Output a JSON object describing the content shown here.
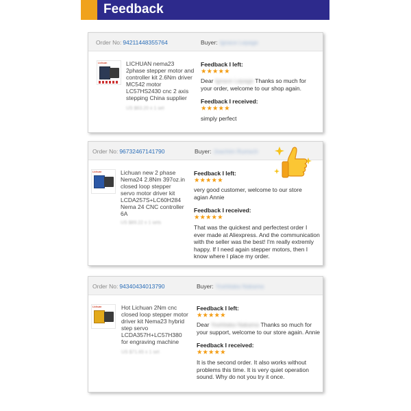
{
  "header": {
    "title": "Feedback"
  },
  "labels": {
    "order_no": "Order No:",
    "buyer": "Buyer:",
    "feedback_left": "Feedback I left:",
    "feedback_received": "Feedback I received:"
  },
  "orders": [
    {
      "order_no": "94211448355764",
      "buyer": "Ignace Lepage",
      "product": "LICHUAN nema23 2phase stepper motor and controller kit 2.6Nm driver MC542 motor LC57HS2430 cnc 2 axis stepping China supplier",
      "price": "US $63.20 x 1 set",
      "stars_left": "★★★★★",
      "left_prefix": "Dear",
      "left_name": "Ignace Lepage",
      "left_text": "Thanks so much for your order, welcome to our shop again.",
      "stars_received": "★★★★★",
      "received_text": "simply perfect"
    },
    {
      "order_no": "96732467141790",
      "buyer": "Joachim Rumsch",
      "product": "Lichuan new 2 phase Nema24 2.8Nm 397oz.in closed loop stepper servo motor driver kit LCDA257S+LC60H284 Nema 24 CNC controller 6A",
      "price": "US $89.22 x 1 sets",
      "stars_left": "★★★★★",
      "left_text": "very good customer, welcome to our store agian Annie",
      "stars_received": "★★★★★",
      "received_text": "That was the quickest and perfectest order I ever made at Aliexpress. And the communication with the seller was the best! I'm really extremly happy. If I need again stepper motors, then I know where I place my order."
    },
    {
      "order_no": "94340434013790",
      "buyer": "Yoshitaka Nakama",
      "product": "Hot Lichuan 2Nm cnc closed loop stepper motor driver kit Nema23 hybrid step servo LCDA357H+LC57H380 for engraving machine",
      "price": "US $71.65 x 1 set",
      "stars_left": "★★★★★",
      "left_prefix": "Dear",
      "left_name": "Yoshitaka Nakama",
      "left_text": "Thanks so much for your support, welcome to our store again. Annie",
      "stars_received": "★★★★★",
      "received_text": "It is the second order. It also works without problems this time. It is very quiet operation sound. Why do not you try it once."
    }
  ],
  "colors": {
    "header_bg": "#2d2a8c",
    "accent": "#f0a21c",
    "link": "#2a6db8",
    "star": "#f39c12"
  },
  "icons": {
    "thumbs_up": "thumbs-up-emoji-icon"
  }
}
